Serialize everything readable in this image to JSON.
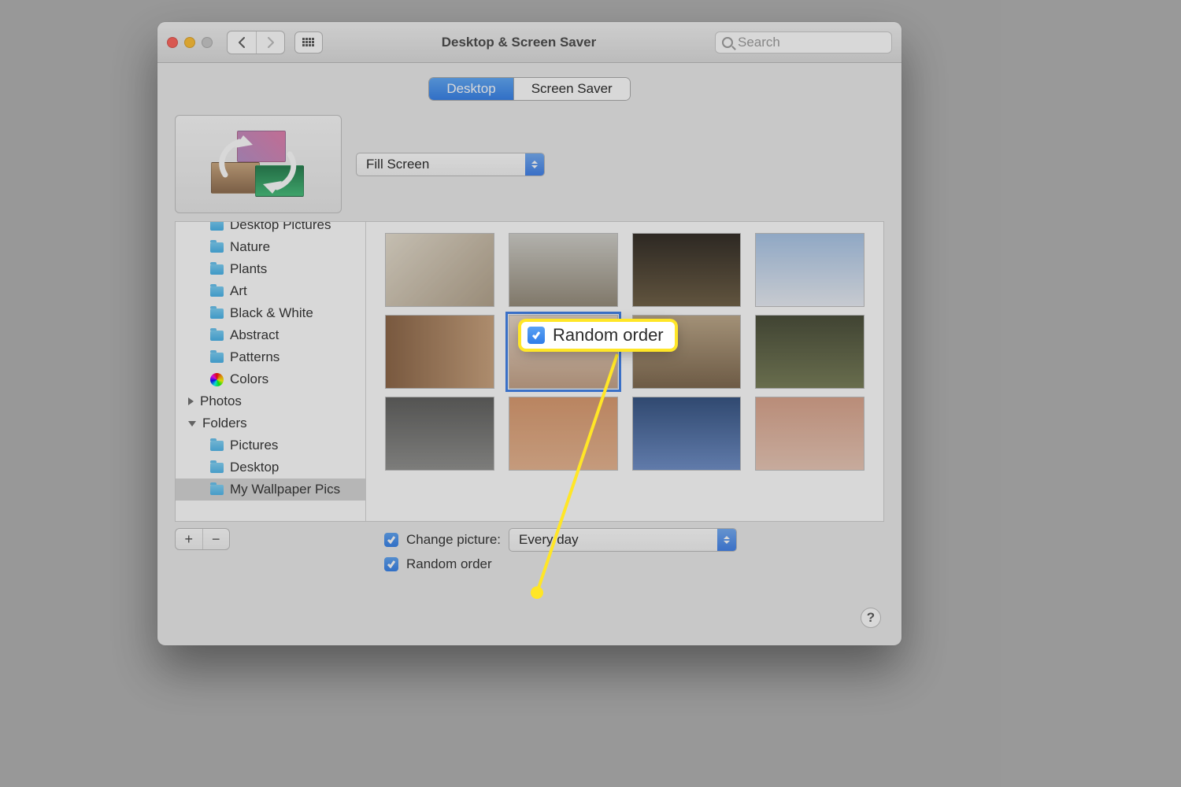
{
  "window": {
    "title": "Desktop & Screen Saver",
    "search_placeholder": "Search"
  },
  "tabs": {
    "desktop": "Desktop",
    "screensaver": "Screen Saver",
    "active": "desktop"
  },
  "fill_mode": {
    "selected": "Fill Screen"
  },
  "sidebar": {
    "apple_children": [
      "Desktop Pictures",
      "Nature",
      "Plants",
      "Art",
      "Black & White",
      "Abstract",
      "Patterns",
      "Colors"
    ],
    "photos_label": "Photos",
    "folders_label": "Folders",
    "folders_children": [
      "Pictures",
      "Desktop",
      "My Wallpaper Pics"
    ],
    "selected": "My Wallpaper Pics"
  },
  "thumb_selected_index": 5,
  "toolbar": {
    "plus": "+",
    "minus": "−"
  },
  "options": {
    "change_label": "Change picture:",
    "change_checked": true,
    "interval_selected": "Every day",
    "random_label": "Random order",
    "random_checked": true
  },
  "help_label": "?",
  "callout": {
    "label": "Random order",
    "checked": true
  }
}
